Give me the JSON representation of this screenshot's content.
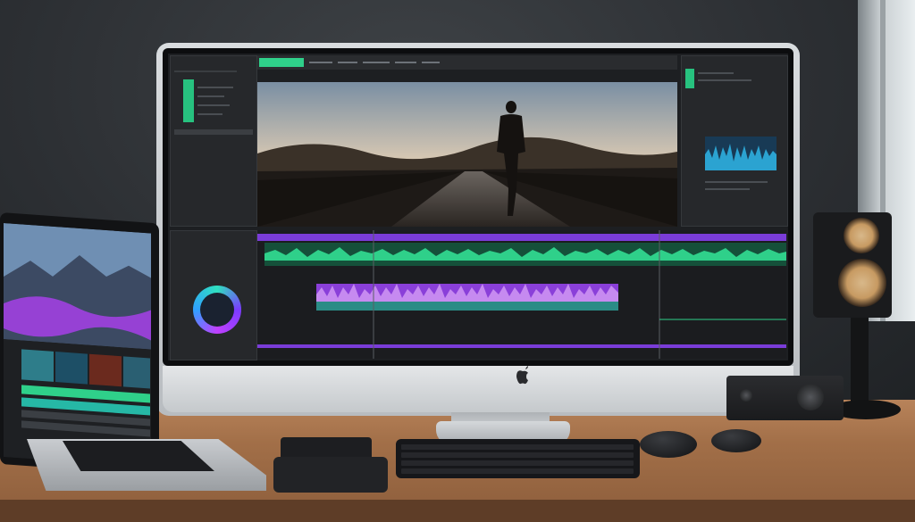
{
  "scene": "desk-setup",
  "editor": {
    "menu_items": [
      "",
      "",
      "",
      "",
      "",
      "",
      ""
    ],
    "active_menu_index": 0
  },
  "colors": {
    "accent_green": "#2fd08a",
    "waveform_purple": "#9b45e8",
    "waveform_cyan": "#2bb8b0",
    "track_green": "#26b86e"
  },
  "icons": {
    "brand": "apple-logo-icon",
    "color_wheel": "color-wheel-icon"
  }
}
